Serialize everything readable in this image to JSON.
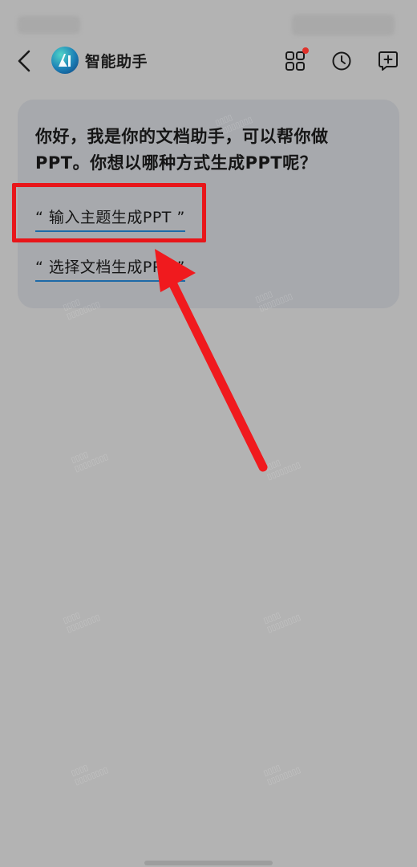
{
  "header": {
    "title": "智能助手",
    "back_icon": "chevron-left-icon",
    "apps_icon": "grid-icon",
    "history_icon": "clock-icon",
    "new_chat_icon": "plus-chat-icon"
  },
  "message": {
    "greeting": "你好，我是你的文档助手，可以帮你做PPT。你想以哪种方式生成PPT呢？",
    "options": [
      {
        "label": "“ 输入主题生成PPT ”"
      },
      {
        "label": "“ 选择文档生成PPT ”"
      }
    ]
  },
  "annotation": {
    "highlight_color": "#e8161a",
    "arrow_color": "#f01a1e"
  }
}
